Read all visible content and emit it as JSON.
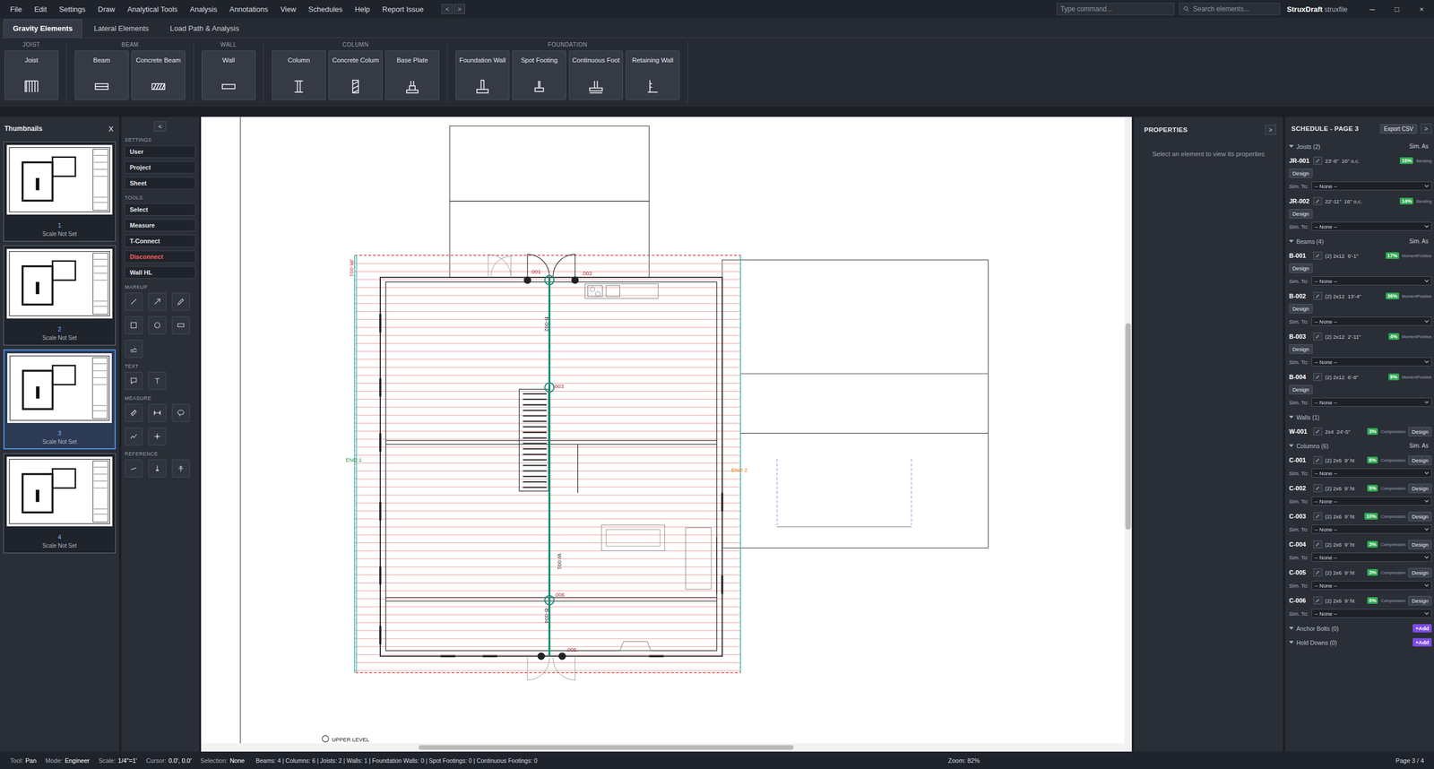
{
  "menu": [
    "File",
    "Edit",
    "Settings",
    "Draw",
    "Analytical Tools",
    "Analysis",
    "Annotations",
    "View",
    "Schedules",
    "Help",
    "Report Issue"
  ],
  "nav_arrows": [
    "<",
    ">"
  ],
  "command": {
    "placeholder": "Type command..."
  },
  "search": {
    "placeholder": "Search elements..."
  },
  "brand": {
    "name": "StruxDraft",
    "file": "struxfile"
  },
  "window_controls": [
    "─",
    "□",
    "×"
  ],
  "tabs": [
    {
      "label": "Gravity Elements",
      "selected": true
    },
    {
      "label": "Lateral Elements",
      "selected": false
    },
    {
      "label": "Load Path & Analysis",
      "selected": false
    }
  ],
  "ribbon": [
    {
      "title": "JOIST",
      "buttons": [
        {
          "label": "Joist",
          "kind": "joist"
        }
      ]
    },
    {
      "title": "BEAM",
      "buttons": [
        {
          "label": "Beam",
          "kind": "beam"
        },
        {
          "label": "Concrete Beam",
          "kind": "concrete-beam"
        }
      ]
    },
    {
      "title": "WALL",
      "buttons": [
        {
          "label": "Wall",
          "kind": "wall"
        }
      ]
    },
    {
      "title": "COLUMN",
      "buttons": [
        {
          "label": "Column",
          "kind": "column"
        },
        {
          "label": "Concrete Colum",
          "kind": "concrete-column"
        },
        {
          "label": "Base Plate",
          "kind": "base-plate"
        }
      ]
    },
    {
      "title": "FOUNDATION",
      "buttons": [
        {
          "label": "Foundation Wall",
          "kind": "foundation-wall"
        },
        {
          "label": "Spot Footing",
          "kind": "spot-footing"
        },
        {
          "label": "Continuous Foot",
          "kind": "continuous-footing"
        },
        {
          "label": "Retaining Wall",
          "kind": "retaining-wall"
        }
      ]
    }
  ],
  "thumbnails": {
    "title": "Thumbnails",
    "close": "X",
    "pages": [
      {
        "number": "1",
        "scale": "Scale Not Set",
        "selected": false
      },
      {
        "number": "2",
        "scale": "Scale Not Set",
        "selected": false
      },
      {
        "number": "3",
        "scale": "Scale Not Set",
        "selected": true
      },
      {
        "number": "4",
        "scale": "Scale Not Set",
        "selected": false
      }
    ]
  },
  "tools": {
    "collapse": "<",
    "sections": [
      {
        "title": "SETTINGS",
        "kind": "buttons",
        "items": [
          {
            "label": "User",
            "danger": false
          },
          {
            "label": "Project",
            "danger": false
          },
          {
            "label": "Sheet",
            "danger": false
          }
        ]
      },
      {
        "title": "TOOLS",
        "kind": "buttons",
        "items": [
          {
            "label": "Select",
            "danger": false
          },
          {
            "label": "Measure",
            "danger": false
          },
          {
            "label": "T-Connect",
            "danger": false
          },
          {
            "label": "Disconnect",
            "danger": true
          },
          {
            "label": "Wall HL",
            "danger": false
          }
        ]
      },
      {
        "title": "MARKUP",
        "kind": "icons",
        "items": [
          {
            "kind": "line"
          },
          {
            "kind": "arrow"
          },
          {
            "kind": "pencil"
          },
          {
            "kind": "square"
          },
          {
            "kind": "circle"
          },
          {
            "kind": "rectangle"
          },
          {
            "kind": "signature"
          }
        ]
      },
      {
        "title": "TEXT",
        "kind": "icons",
        "items": [
          {
            "kind": "comment"
          },
          {
            "kind": "text"
          }
        ]
      },
      {
        "title": "MEASURE",
        "kind": "icons",
        "items": [
          {
            "kind": "ruler"
          },
          {
            "kind": "dimension"
          },
          {
            "kind": "lasso"
          },
          {
            "kind": "polyline"
          },
          {
            "kind": "point"
          }
        ]
      },
      {
        "title": "REFERENCE",
        "kind": "icons",
        "items": [
          {
            "kind": "ref-line"
          },
          {
            "kind": "ref-down"
          },
          {
            "kind": "ref-cross"
          }
        ]
      }
    ]
  },
  "canvas": {
    "labels": [
      {
        "text": "JR-001",
        "color": "#d03030"
      },
      {
        "text": "B-002",
        "color": "#333333"
      },
      {
        "text": "W-001",
        "color": "#333333"
      },
      {
        "text": "B-004",
        "color": "#333333"
      },
      {
        "text": "END 1",
        "color": "#2a9a4a"
      },
      {
        "text": "END 2",
        "color": "#e08a00"
      },
      {
        "text": ".001",
        "color": "#b03030"
      },
      {
        "text": ".002",
        "color": "#b03030"
      },
      {
        "text": ".003",
        "color": "#b03030"
      },
      {
        "text": ".006",
        "color": "#b03030"
      },
      {
        "text": ".005",
        "color": "#b03030"
      }
    ],
    "level_caption": "UPPER LEVEL"
  },
  "properties": {
    "title": "PROPERTIES",
    "toggle": ">",
    "empty": "Select an element to view its properties"
  },
  "schedule": {
    "title": "SCHEDULE - PAGE 3",
    "export": "Export CSV",
    "toggle": ">",
    "sections": [
      {
        "title": "Joists (2)",
        "expanded": true,
        "header_right": "Sim. As",
        "layout": "stacked",
        "items": [
          {
            "id": "JR-001",
            "spec": "23'-8\"  16\" o.c.",
            "pct": "15%",
            "check": "Bending",
            "design": "Design",
            "sim_label": "Sim. To:",
            "sim_value": "-- None --"
          },
          {
            "id": "JR-002",
            "spec": "22'-11\"  16\" o.c.",
            "pct": "14%",
            "check": "Bending",
            "design": "Design",
            "sim_label": "Sim. To:",
            "sim_value": "-- None --"
          }
        ]
      },
      {
        "title": "Beams (4)",
        "expanded": true,
        "header_right": "Sim. As",
        "layout": "stacked",
        "items": [
          {
            "id": "B-001",
            "spec": "(2) 2x12  6'-1\"",
            "pct": "17%",
            "check": "MomentPositive",
            "design": "Design",
            "sim_label": "Sim. To:",
            "sim_value": "-- None --"
          },
          {
            "id": "B-002",
            "spec": "(2) 2x12  13'-4\"",
            "pct": "36%",
            "check": "MomentPositive",
            "design": "Design",
            "sim_label": "Sim. To:",
            "sim_value": "-- None --"
          },
          {
            "id": "B-003",
            "spec": "(2) 2x12  2'-11\"",
            "pct": "4%",
            "check": "MomentPositive",
            "design": "Design",
            "sim_label": "Sim. To:",
            "sim_value": "-- None --"
          },
          {
            "id": "B-004",
            "spec": "(2) 2x12  6'-8\"",
            "pct": "9%",
            "check": "MomentPositive",
            "design": "Design",
            "sim_label": "Sim. To:",
            "sim_value": "-- None --"
          }
        ]
      },
      {
        "title": "Walls (1)",
        "expanded": true,
        "layout": "inline",
        "items": [
          {
            "id": "W-001",
            "spec": "2x4  24'-5\"",
            "pct": "3%",
            "check": "Compression",
            "design": "Design"
          }
        ]
      },
      {
        "title": "Columns (6)",
        "expanded": true,
        "header_right": "Sim. As",
        "layout": "inline",
        "items": [
          {
            "id": "C-001",
            "spec": "(2) 2x6  9' ht",
            "pct": "6%",
            "check": "Compression",
            "design": "Design",
            "sim_label": "Sim. To:",
            "sim_value": "-- None --"
          },
          {
            "id": "C-002",
            "spec": "(2) 2x6  9' ht",
            "pct": "5%",
            "check": "Compression",
            "design": "Design",
            "sim_label": "Sim. To:",
            "sim_value": "-- None --"
          },
          {
            "id": "C-003",
            "spec": "(2) 2x6  9' ht",
            "pct": "10%",
            "check": "Compression",
            "design": "Design",
            "sim_label": "Sim. To:",
            "sim_value": "-- None --"
          },
          {
            "id": "C-004",
            "spec": "(2) 2x6  9' ht",
            "pct": "3%",
            "check": "Compression",
            "design": "Design",
            "sim_label": "Sim. To:",
            "sim_value": "-- None --"
          },
          {
            "id": "C-005",
            "spec": "(2) 2x6  9' ht",
            "pct": "3%",
            "check": "Compression",
            "design": "Design",
            "sim_label": "Sim. To:",
            "sim_value": "-- None --"
          },
          {
            "id": "C-006",
            "spec": "(2) 2x6  9' ht",
            "pct": "5%",
            "check": "Compression",
            "design": "Design",
            "sim_label": "Sim. To:",
            "sim_value": "-- None --"
          }
        ]
      },
      {
        "title": "Anchor Bolts (0)",
        "expanded": true,
        "add": "+Add",
        "layout": "inline",
        "items": []
      },
      {
        "title": "Hold Downs (0)",
        "expanded": true,
        "add": "+Add",
        "layout": "inline",
        "items": []
      }
    ]
  },
  "status_bar": {
    "items": [
      {
        "label": "Tool:",
        "value": "Pan"
      },
      {
        "label": "Mode:",
        "value": "Engineer"
      },
      {
        "label": "Scale:",
        "value": "1/4\"=1'"
      },
      {
        "label": "Cursor:",
        "value": "0.0', 0.0'"
      },
      {
        "label": "Selection:",
        "value": "None"
      }
    ],
    "counts": "Beams: 4 | Columns: 6 | Joists: 2 | Walls: 1 | Foundation Walls: 0 | Spot Footings: 0 | Continuous Footings: 0",
    "zoom": "Zoom: 82%",
    "page": "Page 3 / 4"
  }
}
